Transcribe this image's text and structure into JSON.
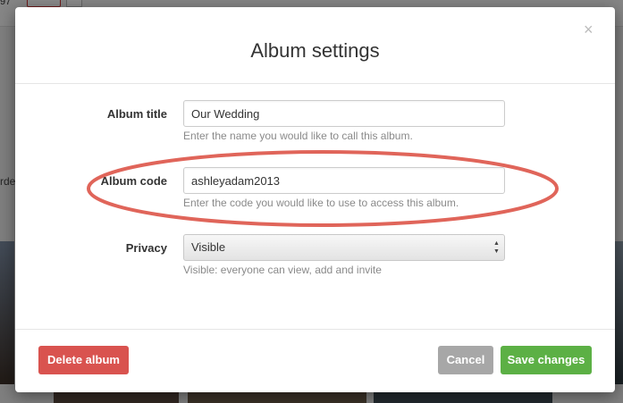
{
  "background": {
    "left_fragment_top": "97",
    "left_fragment_side": "rde"
  },
  "modal": {
    "title": "Album settings",
    "close_icon": "close-icon"
  },
  "form": {
    "album_title": {
      "label": "Album title",
      "value": "Our Wedding",
      "help": "Enter the name you would like to call this album."
    },
    "album_code": {
      "label": "Album code",
      "value": "ashleyadam2013",
      "help": "Enter the code you would like to use to access this album."
    },
    "privacy": {
      "label": "Privacy",
      "selected": "Visible",
      "help": "Visible: everyone can view, add and invite"
    }
  },
  "footer": {
    "delete_label": "Delete album",
    "cancel_label": "Cancel",
    "save_label": "Save changes"
  },
  "colors": {
    "delete": "#d9534f",
    "cancel": "#a7a7a7",
    "save": "#5cb045",
    "annotation": "#e0655a"
  },
  "annotation": {
    "shape": "ellipse",
    "highlights": "album_code"
  }
}
